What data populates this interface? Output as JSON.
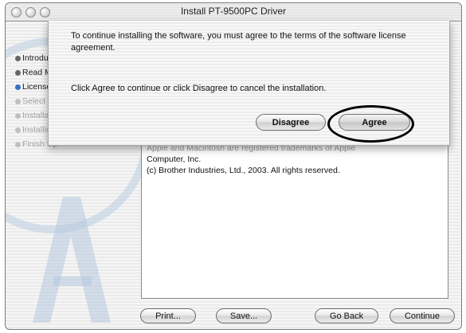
{
  "window": {
    "title": "Install PT-9500PC Driver"
  },
  "sidebar": {
    "steps": [
      {
        "label": "Introduction",
        "state": "done"
      },
      {
        "label": "Read Me",
        "state": "done"
      },
      {
        "label": "License",
        "state": "current"
      },
      {
        "label": "Select Destination",
        "state": "pending"
      },
      {
        "label": "Installation Type",
        "state": "pending"
      },
      {
        "label": "Installing",
        "state": "pending"
      },
      {
        "label": "Finish Up",
        "state": "pending"
      }
    ]
  },
  "license": {
    "line1": "Apple and Macintosh are registered trademarks of Apple",
    "line2": "Computer, Inc.",
    "line3": "(c) Brother Industries, Ltd., 2003. All rights reserved."
  },
  "buttons": {
    "print": "Print...",
    "save": "Save...",
    "go_back": "Go Back",
    "continue": "Continue"
  },
  "sheet": {
    "message1": "To continue installing the software, you must agree to the terms of the software license agreement.",
    "message2": "Click Agree to continue or click Disagree to cancel the installation.",
    "disagree": "Disagree",
    "agree": "Agree"
  }
}
